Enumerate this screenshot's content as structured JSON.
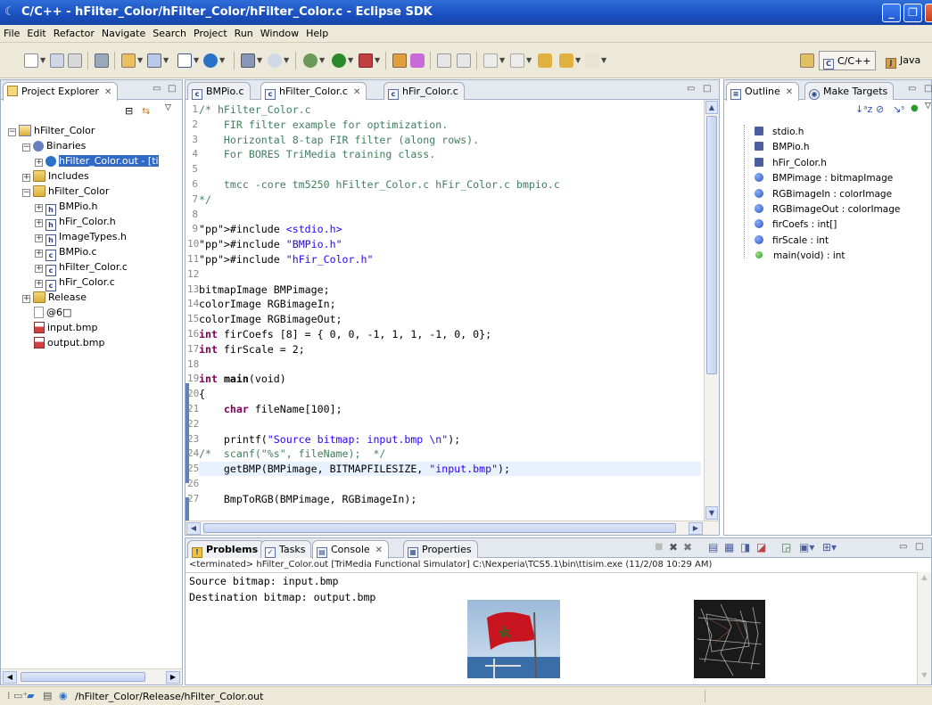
{
  "window": {
    "title": "C/C++ - hFilter_Color/hFilter_Color/hFilter_Color.c - Eclipse SDK"
  },
  "menu": [
    "File",
    "Edit",
    "Refactor",
    "Navigate",
    "Search",
    "Project",
    "Run",
    "Window",
    "Help"
  ],
  "perspectives": {
    "cpp": "C/C++",
    "java": "Java"
  },
  "explorer": {
    "tab": "Project Explorer",
    "tree": [
      {
        "label": "hFilter_Color"
      },
      {
        "label": "Binaries"
      },
      {
        "label": "hFilter_Color.out - [ti"
      },
      {
        "label": "Includes"
      },
      {
        "label": "hFilter_Color"
      },
      {
        "label": "BMPio.h"
      },
      {
        "label": "hFir_Color.h"
      },
      {
        "label": "ImageTypes.h"
      },
      {
        "label": "BMPio.c"
      },
      {
        "label": "hFilter_Color.c"
      },
      {
        "label": "hFir_Color.c"
      },
      {
        "label": "Release"
      },
      {
        "label": "@6□"
      },
      {
        "label": "input.bmp"
      },
      {
        "label": "output.bmp"
      }
    ]
  },
  "editor": {
    "tabs": [
      "BMPio.c",
      "hFilter_Color.c",
      "hFir_Color.c"
    ],
    "lines": [
      {
        "n": "1",
        "t": "/* hFilter_Color.c"
      },
      {
        "n": "2",
        "t": "    FIR filter example for optimization."
      },
      {
        "n": "3",
        "t": "    Horizontal 8-tap FIR filter (along rows)."
      },
      {
        "n": "4",
        "t": "    For BORES TriMedia training class."
      },
      {
        "n": "5",
        "t": ""
      },
      {
        "n": "6",
        "t": "    tmcc -core tm5250 hFilter_Color.c hFir_Color.c bmpio.c"
      },
      {
        "n": "7",
        "t": "*/"
      },
      {
        "n": "8",
        "t": ""
      },
      {
        "n": "9",
        "t": "#include <stdio.h>"
      },
      {
        "n": "10",
        "t": "#include \"BMPio.h\""
      },
      {
        "n": "11",
        "t": "#include \"hFir_Color.h\""
      },
      {
        "n": "12",
        "t": ""
      },
      {
        "n": "13",
        "t": "bitmapImage BMPimage;"
      },
      {
        "n": "14",
        "t": "colorImage RGBimageIn;"
      },
      {
        "n": "15",
        "t": "colorImage RGBimageOut;"
      },
      {
        "n": "16",
        "t": "int firCoefs [8] = { 0, 0, -1, 1, 1, -1, 0, 0};"
      },
      {
        "n": "17",
        "t": "int firScale = 2;"
      },
      {
        "n": "18",
        "t": ""
      },
      {
        "n": "19",
        "t": "int main(void)"
      },
      {
        "n": "20",
        "t": "{"
      },
      {
        "n": "21",
        "t": "    char fileName[100];"
      },
      {
        "n": "22",
        "t": ""
      },
      {
        "n": "23",
        "t": "    printf(\"Source bitmap: input.bmp \\n\");"
      },
      {
        "n": "24",
        "t": "/*  scanf(\"%s\", fileName);  */"
      },
      {
        "n": "25",
        "t": "    getBMP(BMPimage, BITMAPFILESIZE, \"input.bmp\");"
      },
      {
        "n": "26",
        "t": ""
      },
      {
        "n": "27",
        "t": "    BmpToRGB(BMPimage, RGBimageIn);"
      }
    ]
  },
  "outline": {
    "tabs": [
      "Outline",
      "Make Targets"
    ],
    "items": [
      {
        "kind": "include",
        "label": "stdio.h"
      },
      {
        "kind": "include",
        "label": "BMPio.h"
      },
      {
        "kind": "include",
        "label": "hFir_Color.h"
      },
      {
        "kind": "var",
        "label": "BMPimage : bitmapImage"
      },
      {
        "kind": "var",
        "label": "RGBimageIn : colorImage"
      },
      {
        "kind": "var",
        "label": "RGBimageOut : colorImage"
      },
      {
        "kind": "var",
        "label": "firCoefs : int[]"
      },
      {
        "kind": "var",
        "label": "firScale : int"
      },
      {
        "kind": "func",
        "label": "main(void) : int"
      }
    ]
  },
  "console": {
    "tabs": [
      "Problems",
      "Tasks",
      "Console",
      "Properties"
    ],
    "path": "<terminated> hFilter_Color.out [TriMedia Functional Simulator] C:\\Nexperia\\TCS5.1\\bin\\ttisim.exe (11/2/08 10:29 AM)",
    "lines": [
      "Source bitmap: input.bmp",
      "Destination bitmap: output.bmp"
    ]
  },
  "status": {
    "text": "/hFilter_Color/Release/hFilter_Color.out"
  }
}
